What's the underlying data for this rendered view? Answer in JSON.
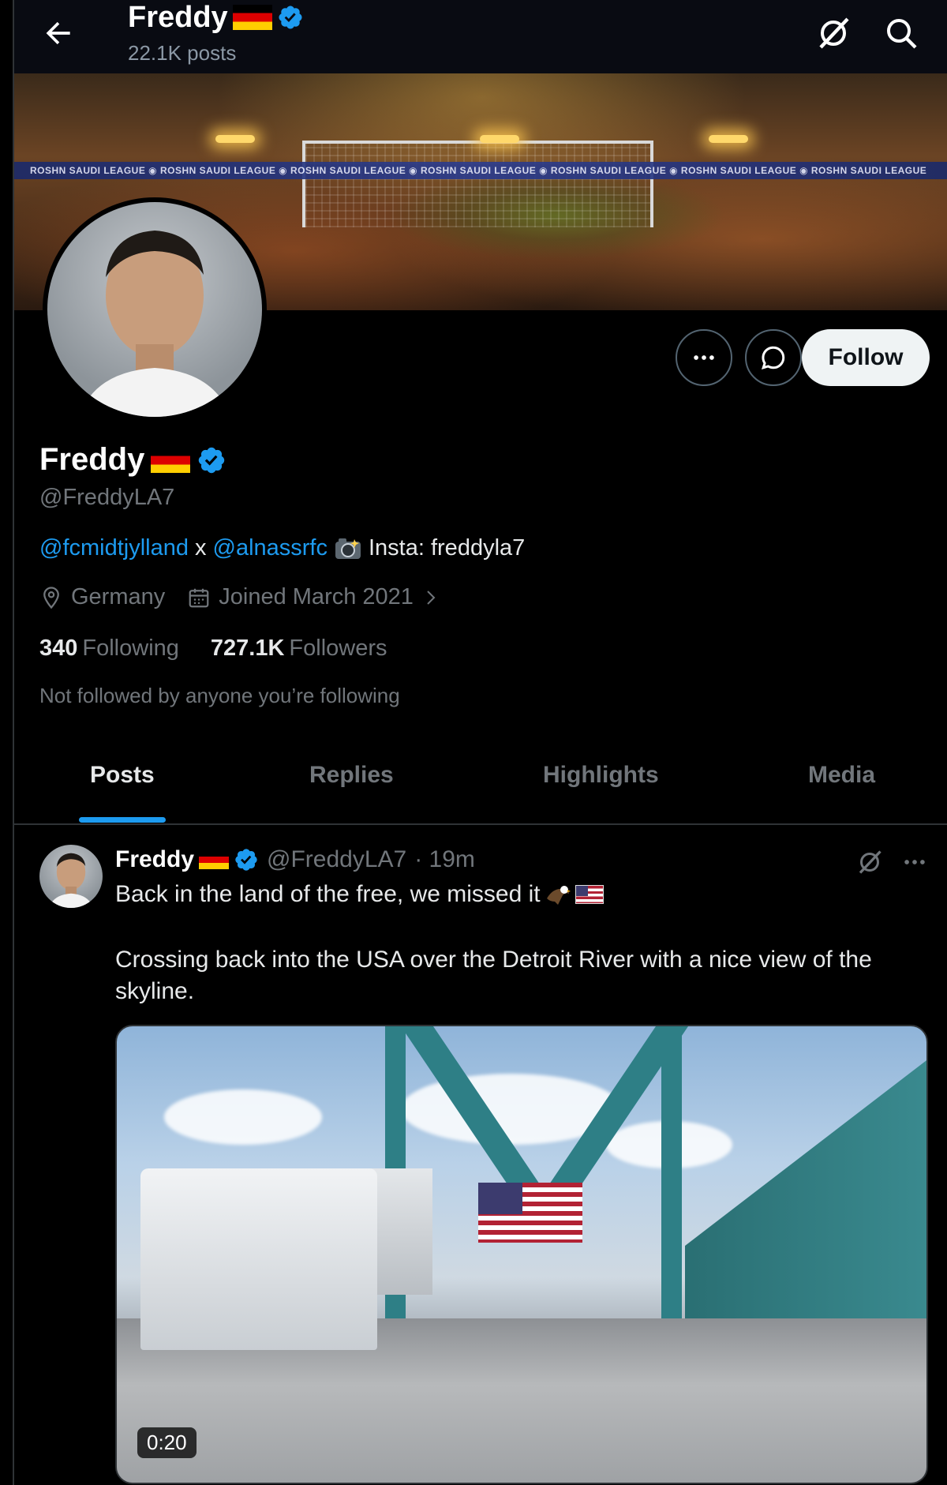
{
  "header": {
    "title": "Freddy",
    "posts_count": "22.1K posts"
  },
  "banner": {
    "ad_text": "ROSHN SAUDI LEAGUE  ◉  ROSHN SAUDI LEAGUE  ◉  ROSHN SAUDI LEAGUE  ◉  ROSHN SAUDI LEAGUE  ◉  ROSHN SAUDI LEAGUE  ◉  ROSHN SAUDI LEAGUE  ◉  ROSHN SAUDI LEAGUE"
  },
  "actions": {
    "follow_label": "Follow"
  },
  "profile": {
    "name": "Freddy",
    "handle": "@FreddyLA7",
    "bio_link1": "@fcmidtjylland",
    "bio_sep": "x",
    "bio_link2": "@alnassrfc",
    "bio_text": "Insta: freddyla7",
    "location": "Germany",
    "joined": "Joined March 2021",
    "following_count": "340",
    "following_label": "Following",
    "followers_count": "727.1K",
    "followers_label": "Followers",
    "not_followed": "Not followed by anyone you’re following"
  },
  "tabs": [
    {
      "label": "Posts",
      "active": true
    },
    {
      "label": "Replies",
      "active": false
    },
    {
      "label": "Highlights",
      "active": false
    },
    {
      "label": "Media",
      "active": false
    }
  ],
  "post": {
    "name": "Freddy",
    "handle": "@FreddyLA7",
    "time": "· 19m",
    "line1": "Back in the land of the free, we missed it",
    "line2": "Crossing back into the USA over the Detroit River with a nice view of the skyline.",
    "video_duration": "0:20"
  },
  "colors": {
    "accent": "#1d9bf0",
    "verified": "#1d9bf0",
    "background": "#000000"
  },
  "icons": [
    "back-arrow-icon",
    "verified-icon",
    "grok-icon",
    "search-icon",
    "more-icon",
    "message-icon",
    "location-icon",
    "calendar-icon",
    "chevron-right-icon",
    "camera-emoji-icon",
    "eagle-emoji-icon",
    "us-flag-emoji-icon",
    "german-flag-emoji-icon"
  ]
}
